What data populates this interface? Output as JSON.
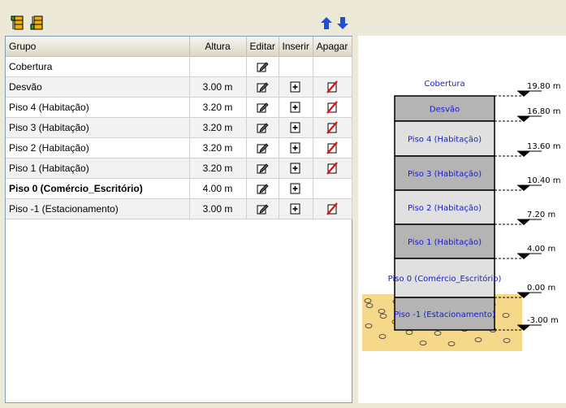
{
  "toolbar": {
    "icons": [
      "add-floor-above-icon",
      "add-floor-below-icon",
      "move-up-arrow-icon",
      "move-down-arrow-icon"
    ],
    "colors": {
      "icon_gold": "#f0b000",
      "icon_green": "#3a9a3a",
      "arrow_blue": "#1f4fd8"
    }
  },
  "table": {
    "headers": {
      "grupo": "Grupo",
      "altura": "Altura",
      "editar": "Editar",
      "inserir": "Inserir",
      "apagar": "Apagar"
    },
    "rows": [
      {
        "name": "Cobertura",
        "altura": "",
        "edit": true,
        "insert": false,
        "delete": false,
        "bold": false
      },
      {
        "name": "Desvão",
        "altura": "3.00 m",
        "edit": true,
        "insert": true,
        "delete": true,
        "bold": false
      },
      {
        "name": "Piso 4 (Habitação)",
        "altura": "3.20 m",
        "edit": true,
        "insert": true,
        "delete": true,
        "bold": false
      },
      {
        "name": "Piso 3 (Habitação)",
        "altura": "3.20 m",
        "edit": true,
        "insert": true,
        "delete": true,
        "bold": false
      },
      {
        "name": "Piso 2 (Habitação)",
        "altura": "3.20 m",
        "edit": true,
        "insert": true,
        "delete": true,
        "bold": false
      },
      {
        "name": "Piso 1 (Habitação)",
        "altura": "3.20 m",
        "edit": true,
        "insert": true,
        "delete": true,
        "bold": false
      },
      {
        "name": "Piso 0 (Comércio_Escritório)",
        "altura": "4.00 m",
        "edit": true,
        "insert": true,
        "delete": false,
        "bold": true
      },
      {
        "name": "Piso -1 (Estacionamento)",
        "altura": "3.00 m",
        "edit": true,
        "insert": true,
        "delete": true,
        "bold": false
      }
    ],
    "icons": {
      "edit": "pencil-edit-icon",
      "insert": "insert-plus-icon",
      "delete": "delete-strike-icon"
    }
  },
  "section": {
    "label_color": "#1a1acd",
    "fill_light": "#e0e0e0",
    "fill_dark": "#b4b4b4",
    "soil_color": "#f5d889",
    "top_label": "Cobertura",
    "floors": [
      {
        "name": "Desvão",
        "fill": "dark"
      },
      {
        "name": "Piso 4 (Habitação)",
        "fill": "light"
      },
      {
        "name": "Piso 3 (Habitação)",
        "fill": "dark"
      },
      {
        "name": "Piso 2 (Habitação)",
        "fill": "light"
      },
      {
        "name": "Piso 1 (Habitação)",
        "fill": "dark"
      },
      {
        "name": "Piso 0 (Comércio_Escritório)",
        "fill": "light"
      },
      {
        "name": "Piso -1 (Estacionamento)",
        "fill": "dark"
      }
    ],
    "levels": [
      "19.80 m",
      "16.80 m",
      "13.60 m",
      "10.40 m",
      "7.20 m",
      "4.00 m",
      "0.00 m",
      "-3.00 m"
    ]
  }
}
